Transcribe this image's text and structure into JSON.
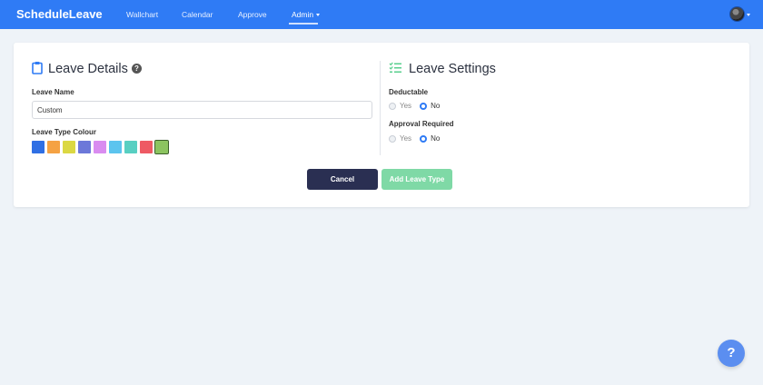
{
  "app": {
    "brand": "ScheduleLeave"
  },
  "nav": {
    "items": [
      {
        "label": "Wallchart"
      },
      {
        "label": "Calendar"
      },
      {
        "label": "Approve"
      },
      {
        "label": "Admin"
      }
    ],
    "active": "Admin"
  },
  "leave_details": {
    "title": "Leave Details",
    "name_label": "Leave Name",
    "name_value": "Custom",
    "colour_label": "Leave Type Colour",
    "colours": [
      "#2f6fe4",
      "#f5a243",
      "#dbd843",
      "#6c78d9",
      "#d98cf0",
      "#5cc4ee",
      "#58cfc2",
      "#ee5a64",
      "#8cc460"
    ],
    "selected_colour_index": 8
  },
  "leave_settings": {
    "title": "Leave Settings",
    "deductable": {
      "label": "Deductable",
      "options": [
        "Yes",
        "No"
      ],
      "selected": "No"
    },
    "approval": {
      "label": "Approval Required",
      "options": [
        "Yes",
        "No"
      ],
      "selected": "No"
    }
  },
  "buttons": {
    "cancel": "Cancel",
    "add": "Add Leave Type"
  },
  "help_fab": "?",
  "colors": {
    "navbar": "#2f7bf5",
    "cancel": "#2a2f52",
    "add": "#7fd9a6",
    "radio_checked": "#2f7bf5"
  }
}
